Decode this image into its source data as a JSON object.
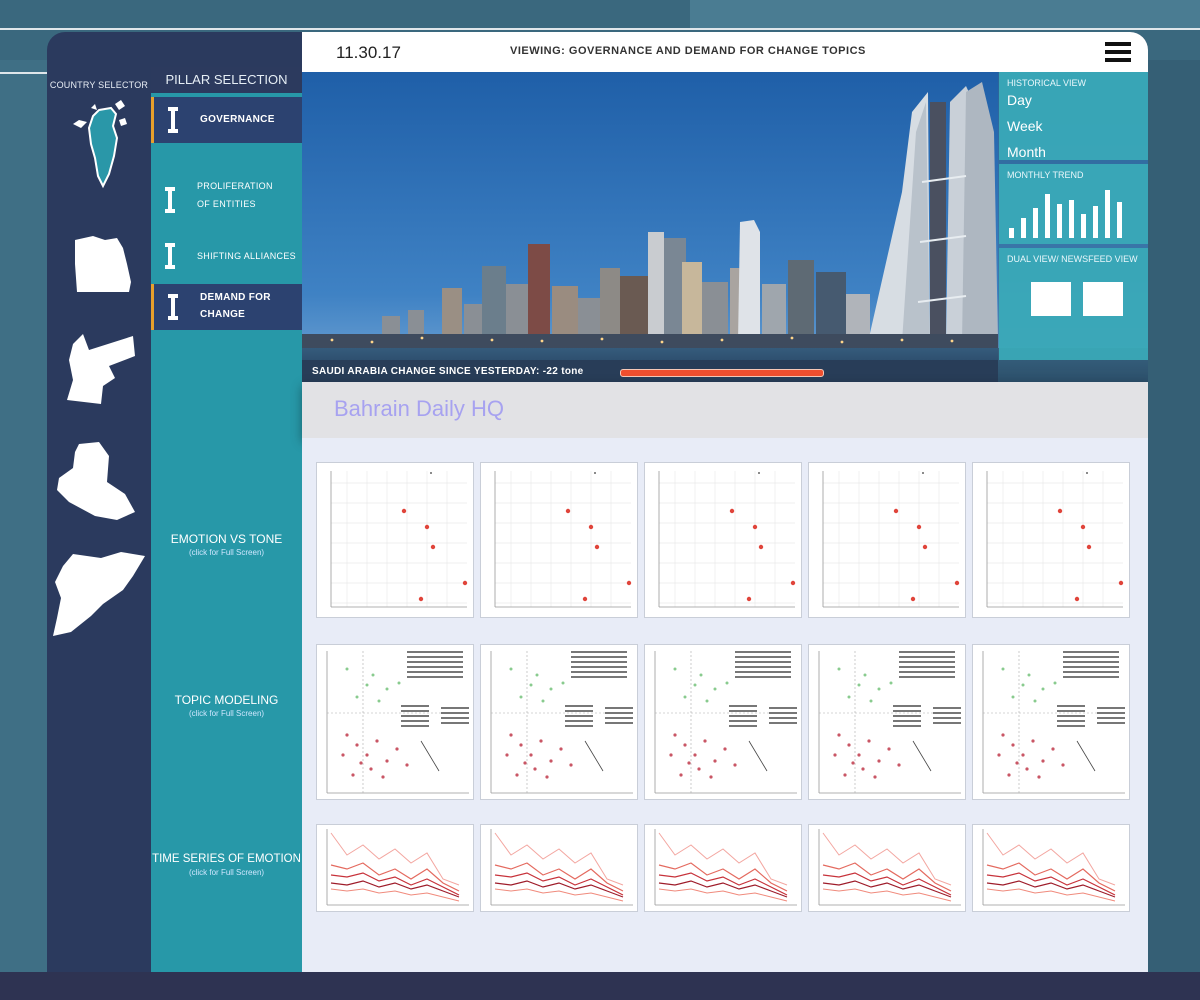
{
  "topbar": {
    "date": "11.30.17",
    "viewing": "VIEWING:  GOVERNANCE AND DEMAND FOR CHANGE TOPICS",
    "menu_icon": "hamburger-menu-icon"
  },
  "country_selector": {
    "title": "COUNTRY SELECTOR",
    "countries": [
      "bahrain-map-icon",
      "egypt-map-icon",
      "jordan-map-icon",
      "algeria-map-icon",
      "syria-map-icon"
    ]
  },
  "pillar_selection": {
    "title": "PILLAR SELECTION",
    "items": [
      {
        "label": "GOVERNANCE",
        "active": true
      },
      {
        "label": "PROLIFERATION OF ENTITIES",
        "line1": "PROLIFERATION",
        "line2": "OF ENTITIES",
        "active": false
      },
      {
        "label": "SHIFTING ALLIANCES",
        "active": false
      },
      {
        "label": "DEMAND FOR CHANGE",
        "line1": "DEMAND FOR",
        "line2": "CHANGE",
        "active": true
      }
    ]
  },
  "sections": [
    {
      "label": "EMOTION VS TONE",
      "hint": "(click for Full Screen)"
    },
    {
      "label": "TOPIC MODELING",
      "hint": "(click for Full Screen)"
    },
    {
      "label": "TIME SERIES OF EMOTION",
      "hint": "(click for Full Screen)"
    }
  ],
  "hero": {
    "change_text": "SAUDI ARABIA CHANGE SINCE YESTERDAY:  -22 tone",
    "change_bar_color": "#ef4f2f"
  },
  "historical_view": {
    "title": "HISTORICAL VIEW",
    "options": [
      "Day",
      "Week",
      "Month"
    ],
    "monthly_trend_title": "MONTHLY TREND",
    "dual_view_title": "DUAL VIEW/ NEWSFEED VIEW"
  },
  "hq": {
    "title": "Bahrain Daily HQ"
  },
  "colors": {
    "sidebar": "#2b3a5e",
    "pillar": "#2798a8",
    "active_pillar": "#2c4270",
    "accent": "#e8a02c",
    "hq_title": "#a7a2f0"
  }
}
